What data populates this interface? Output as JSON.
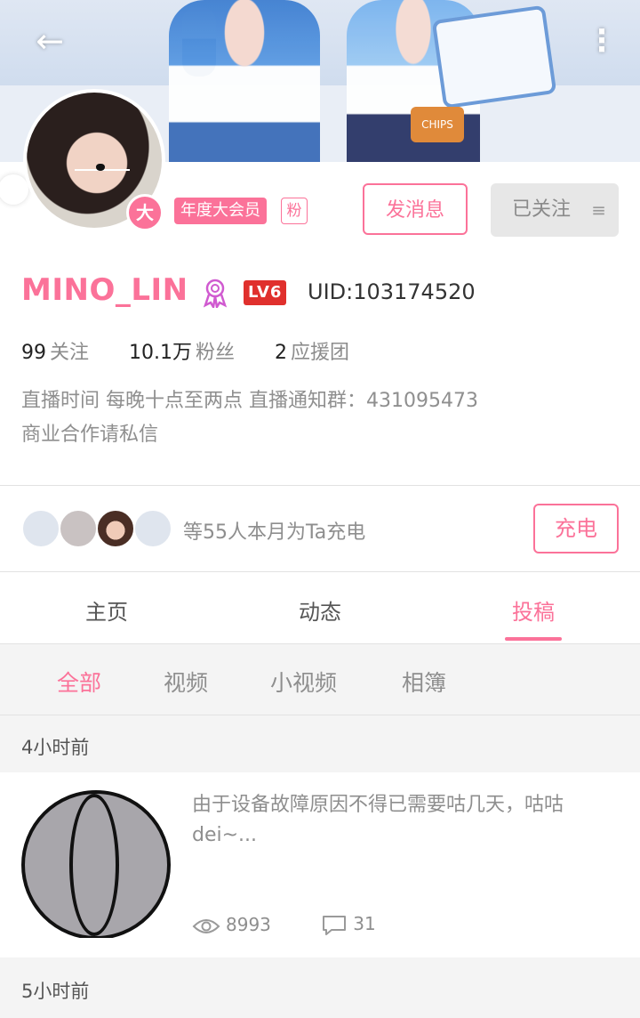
{
  "header": {
    "back_icon": "arrow-left-icon",
    "more_icon": "more-vertical-icon"
  },
  "profile": {
    "avatar_badge": "大",
    "vip_tag": "年度大会员",
    "fan_tag": "粉",
    "message_button": "发消息",
    "follow_button": "已关注",
    "name": "MINO_LIN",
    "level": "LV6",
    "uid": "UID:103174520",
    "stats": [
      {
        "value": "99",
        "label": "关注"
      },
      {
        "value": "10.1万",
        "label": "粉丝"
      },
      {
        "value": "2",
        "label": "应援团"
      }
    ],
    "bio_line1": "直播时间 每晚十点至两点 直播通知群：431095473",
    "bio_line2": "商业合作请私信"
  },
  "charge": {
    "text": "等55人本月为Ta充电",
    "button": "充电"
  },
  "tabs": [
    "主页",
    "动态",
    "投稿"
  ],
  "active_tab": "投稿",
  "subtabs": [
    "全部",
    "视频",
    "小视频",
    "相簿"
  ],
  "active_subtab": "全部",
  "feed": [
    {
      "time": "4小时前",
      "title": "由于设备故障原因不得已需要咕几天，咕咕dei~...",
      "views": "8993",
      "comments": "31"
    },
    {
      "time": "5小时前"
    }
  ],
  "colors": {
    "accent": "#fb7299",
    "level_red": "#e0302d"
  }
}
